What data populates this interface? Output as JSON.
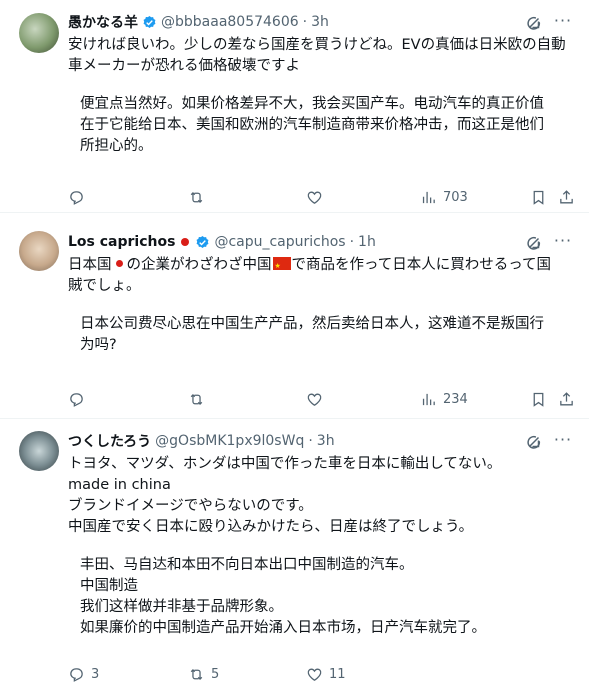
{
  "tweets": [
    {
      "name": "愚かなる羊",
      "handle": "@bbbaaa80574606",
      "time": "3h",
      "text_lines": [
        "安ければ良いわ。少しの差なら国産を買うけどね。EVの真価は日米欧の自動",
        "車メーカーが恐れる価格破壊ですよ"
      ],
      "translation_lines": [
        "便宜点当然好。如果价格差异不大，我会买国产车。电动汽车的真正价值",
        "在于它能给日本、美国和欧洲的汽车制造商带来价格冲击，而这正是他们",
        "所担心的。"
      ],
      "replies": "",
      "retweets": "",
      "likes": "",
      "views": "703"
    },
    {
      "name": "Los caprichos",
      "handle": "@capu_capurichos",
      "time": "1h",
      "text_line1_a": "日本国",
      "text_line1_b": "の企業がわざわざ中国",
      "text_line1_c": "で商品を作って日本人に買わせるって国",
      "text_line2": "賊でしょ。",
      "translation_lines": [
        "日本公司费尽心思在中国生产产品，然后卖给日本人，这难道不是叛国行",
        "为吗?"
      ],
      "replies": "",
      "retweets": "",
      "likes": "",
      "views": "234"
    },
    {
      "name": "つくしたろう",
      "handle": "@gOsbMK1px9l0sWq",
      "time": "3h",
      "text_lines": [
        "トヨタ、マツダ、ホンダは中国で作った車を日本に輸出してない。",
        "made in china",
        "ブランドイメージでやらないのです。",
        "中国産で安く日本に殴り込みかけたら、日産は終了でしょう。"
      ],
      "translation_lines": [
        "丰田、马自达和本田不向日本出口中国制造的汽车。",
        "中国制造",
        "我们这样做并非基于品牌形象。",
        "如果廉价的中国制造产品开始涌入日本市场，日产汽车就完了。"
      ],
      "replies": "3",
      "retweets": "5",
      "likes": "11",
      "views": ""
    }
  ],
  "icons": [
    "verified-badge-icon",
    "grok-icon",
    "more-icon",
    "reply-icon",
    "retweet-icon",
    "like-icon",
    "views-icon",
    "bookmark-icon",
    "share-icon"
  ],
  "colors": {
    "verified": "#1d9bf0",
    "muted": "#536471",
    "text": "#0f1419",
    "flag_red": "#de2910"
  }
}
